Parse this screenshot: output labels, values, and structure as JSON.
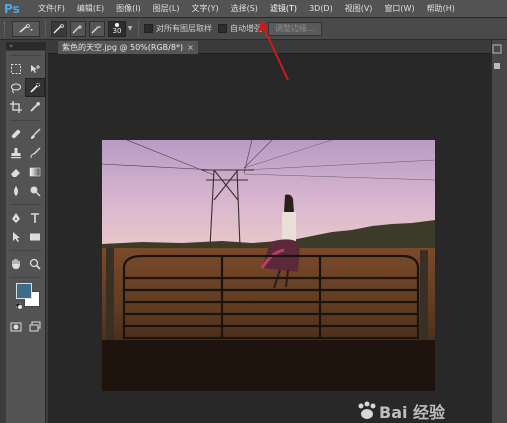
{
  "app": {
    "logo": "Ps"
  },
  "menu": {
    "items": [
      {
        "label": "文件(F)"
      },
      {
        "label": "编辑(E)"
      },
      {
        "label": "图像(I)"
      },
      {
        "label": "图层(L)"
      },
      {
        "label": "文字(Y)"
      },
      {
        "label": "选择(S)"
      },
      {
        "label": "滤镜(T)"
      },
      {
        "label": "3D(D)"
      },
      {
        "label": "视图(V)"
      },
      {
        "label": "窗口(W)"
      },
      {
        "label": "帮助(H)"
      }
    ]
  },
  "options_bar": {
    "brush_size": "30",
    "sample_all_layers_label": "对所有图层取样",
    "auto_enhance_label": "自动增强",
    "refine_edge_label": "调整边缘..."
  },
  "document": {
    "tab_title": "紫色的天空.jpg @ 50%(RGB/8*)",
    "close_glyph": "×"
  },
  "toolbar": {
    "collapse_glyph": "«",
    "foreground_color": "#3f6b8a",
    "background_color": "#ffffff"
  },
  "colors": {
    "annotation_arrow": "#d01a1a",
    "menubar": "#535353",
    "ps_blue": "#4aa7e8"
  },
  "watermark": {
    "text": "Bai 经验"
  }
}
